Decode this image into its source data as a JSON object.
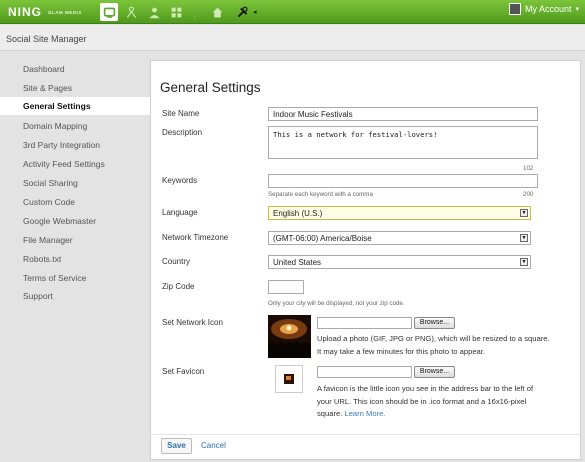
{
  "topbar": {
    "logo": "NING",
    "logo_sub": "GLAM MEDIA",
    "icons": [
      "network-icon",
      "people-icon",
      "member-icon",
      "apps-icon",
      "home-icon",
      "tools-icon"
    ],
    "account_label": "My Account",
    "caret": "▾",
    "brand_color": "#5ca82a"
  },
  "header": {
    "title": "Social Site Manager"
  },
  "sidebar": {
    "items": [
      {
        "label": "Dashboard"
      },
      {
        "label": "Site & Pages"
      },
      {
        "label": "General Settings"
      },
      {
        "label": "Domain Mapping"
      },
      {
        "label": "3rd Party Integration"
      },
      {
        "label": "Activity Feed Settings"
      },
      {
        "label": "Social Sharing"
      },
      {
        "label": "Custom Code"
      },
      {
        "label": "Google Webmaster"
      },
      {
        "label": "File Manager"
      },
      {
        "label": "Robots.txt"
      },
      {
        "label": "Terms of Service"
      },
      {
        "label": "Support"
      }
    ],
    "active_index": 2
  },
  "form": {
    "title": "General Settings",
    "site_name": {
      "label": "Site Name",
      "value": "Indoor Music Festivals"
    },
    "description": {
      "label": "Description",
      "value": "This is a network for festival-lovers!",
      "count": "102"
    },
    "keywords": {
      "label": "Keywords",
      "value": "",
      "hint": "Separate each keyword with a comma",
      "count": "200"
    },
    "language": {
      "label": "Language",
      "value": "English (U.S.)"
    },
    "timezone": {
      "label": "Network Timezone",
      "value": "(GMT-06:00) America/Boise"
    },
    "country": {
      "label": "Country",
      "value": "United States"
    },
    "zip": {
      "label": "Zip Code",
      "value": "",
      "hint": "Only your city will be displayed, not your zip code."
    },
    "network_icon": {
      "label": "Set Network Icon",
      "browse": "Browse...",
      "desc_line1": "Upload a photo (GIF, JPG or PNG), which will be resized to a square.",
      "desc_line2": "It may take a few minutes for this photo to appear."
    },
    "favicon": {
      "label": "Set Favicon",
      "browse": "Browse...",
      "desc_line1": "A favicon is the little icon you see in the address bar to the left of",
      "desc_line2": "your URL. This icon should be in .ico format and a 16x16-pixel",
      "desc_line3": "square.",
      "learn_more": "Learn More."
    },
    "save": "Save",
    "cancel": "Cancel"
  }
}
